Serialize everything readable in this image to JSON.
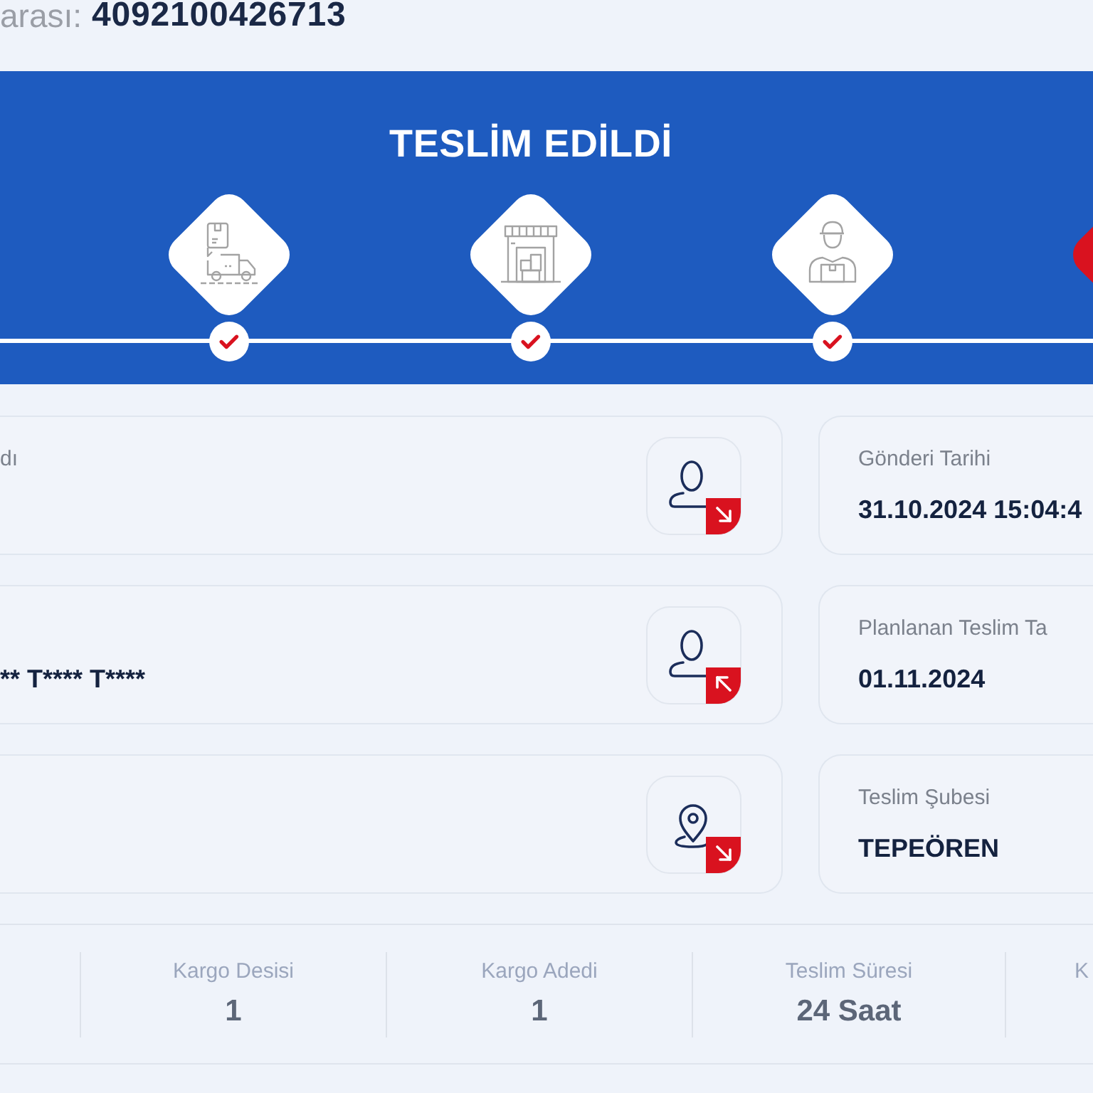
{
  "tracking": {
    "label": "arası:",
    "number": "4092100426713"
  },
  "status": {
    "title": "TESLİM EDİLDİ",
    "steps": [
      {
        "kind": "truck",
        "current": false
      },
      {
        "kind": "store",
        "current": false
      },
      {
        "kind": "courier",
        "current": false
      },
      {
        "current": true
      }
    ],
    "checkpoints": [
      {
        "checked": true
      },
      {
        "checked": true
      },
      {
        "checked": true
      }
    ]
  },
  "parties": [
    {
      "kind": "sender",
      "label": "dı"
    },
    {
      "kind": "receiver",
      "value": "** T**** T****"
    },
    {
      "kind": "location"
    }
  ],
  "details": [
    {
      "label": "Gönderi Tarihi",
      "value": "31.10.2024 15:04:4"
    },
    {
      "label": "Planlanan Teslim Ta",
      "value": "01.11.2024"
    },
    {
      "label": "Teslim Şubesi",
      "value": "TEPEÖREN"
    }
  ],
  "stats": [
    {
      "label": "Kargo Desisi",
      "value": "1"
    },
    {
      "label": "Kargo Adedi",
      "value": "1"
    },
    {
      "label": "Teslim Süresi",
      "value": "24 Saat"
    },
    {
      "label": "K"
    }
  ]
}
